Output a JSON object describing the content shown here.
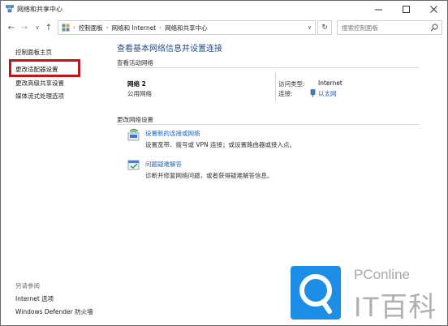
{
  "window": {
    "title": "网络和共享中心"
  },
  "address_bar": {
    "crumbs": [
      "控制面板",
      "网络和 Internet",
      "网络和共享中心"
    ],
    "search_placeholder": "搜索控制面板"
  },
  "sidebar": {
    "items": [
      {
        "label": "控制面板主页"
      },
      {
        "label": "更改适配器设置"
      },
      {
        "label": "更改高级共享设置"
      },
      {
        "label": "媒体流式处理选项"
      }
    ],
    "see_also_title": "另请参阅",
    "see_also": [
      {
        "label": "Internet 选项"
      },
      {
        "label": "Windows Defender 防火墙"
      }
    ]
  },
  "main": {
    "title": "查看基本网络信息并设置连接",
    "active_networks_label": "查看活动网络",
    "network": {
      "name": "网络 2",
      "category": "公用网络",
      "access_type_label": "访问类型:",
      "access_type_value": "Internet",
      "connection_label": "连接:",
      "connection_value": "以太网"
    },
    "change_settings_label": "更改网络设置",
    "settings": [
      {
        "title": "设置新的连接或网络",
        "desc": "设置宽带、拨号或 VPN 连接；或设置路由器或接入点。",
        "icon": "new-connection-icon"
      },
      {
        "title": "问题疑难解答",
        "desc": "诊断并修复网络问题，或者获得疑难解答信息。",
        "icon": "troubleshoot-icon"
      }
    ]
  },
  "watermark": {
    "brand": "PConline",
    "name": "IT百科"
  },
  "colors": {
    "link": "#1a67c6",
    "title": "#1e4d8c",
    "highlight": "#c0161a",
    "watermark_blue": "#1d8ee6"
  }
}
